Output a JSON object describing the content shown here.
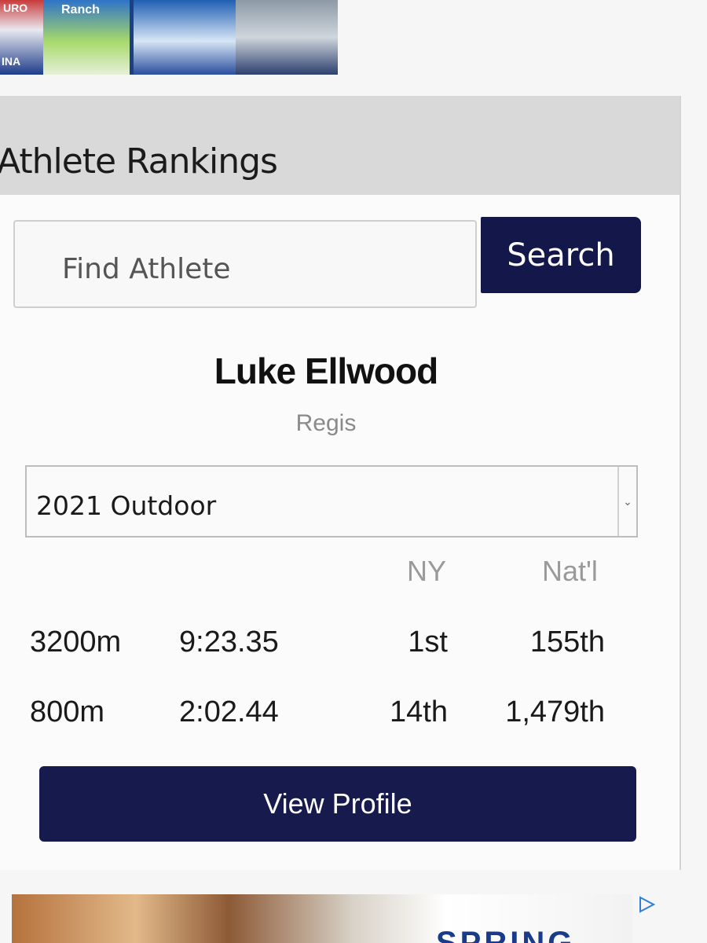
{
  "top_ad": {
    "text_1": "URO",
    "text_2": "Ranch",
    "text_3": "INA"
  },
  "widget": {
    "title": "Athlete Rankings"
  },
  "search": {
    "placeholder": "Find Athlete",
    "button_label": "Search"
  },
  "athlete": {
    "name": "Luke Ellwood",
    "school": "Regis"
  },
  "season_select": {
    "selected": "2021 Outdoor",
    "arrow": "⌄"
  },
  "rankings": {
    "columns": [
      "NY",
      "Nat'l"
    ],
    "rows": [
      {
        "event": "3200m",
        "time": "9:23.35",
        "ny": "1st",
        "natl": "155th"
      },
      {
        "event": "800m",
        "time": "2:02.44",
        "ny": "14th",
        "natl": "1,479th"
      }
    ]
  },
  "view_profile_label": "View Profile",
  "bottom_ad": {
    "word": "SPRING",
    "adchoices_icon": "adchoices-icon"
  },
  "colors": {
    "navy": "#14174a",
    "header_gray": "#d9d9d9"
  }
}
